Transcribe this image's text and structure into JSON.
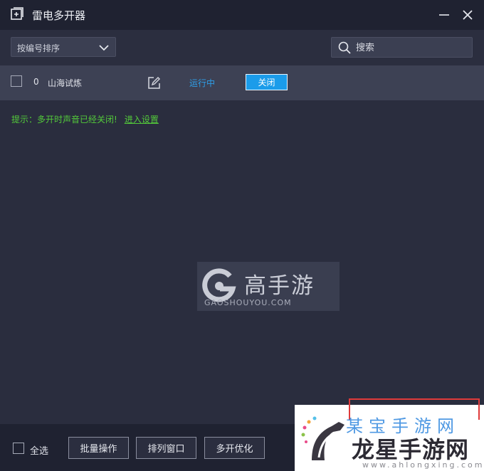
{
  "window": {
    "title": "雷电多开器"
  },
  "toolbar": {
    "sort_label": "按编号排序",
    "search_placeholder": "搜索"
  },
  "instances": [
    {
      "index": "0",
      "name": "山海试炼",
      "status": "运行中",
      "close_label": "关闭"
    }
  ],
  "tip": {
    "text": "提示：多开时声音已经关闭!",
    "link": "进入设置"
  },
  "watermark": {
    "title": "高手游",
    "url": "GAOSHOUYOU.COM"
  },
  "footer": {
    "select_all": "全选",
    "batch": "批量操作",
    "arrange": "排列窗口",
    "optimize": "多开优化"
  },
  "logo": {
    "faded": "某宝手游网",
    "main": "龙星手游网",
    "sub": "www.ahlongxing.com"
  },
  "colors": {
    "accent": "#1b9cea",
    "status": "#2e9fe8",
    "tip": "#53c93a"
  }
}
